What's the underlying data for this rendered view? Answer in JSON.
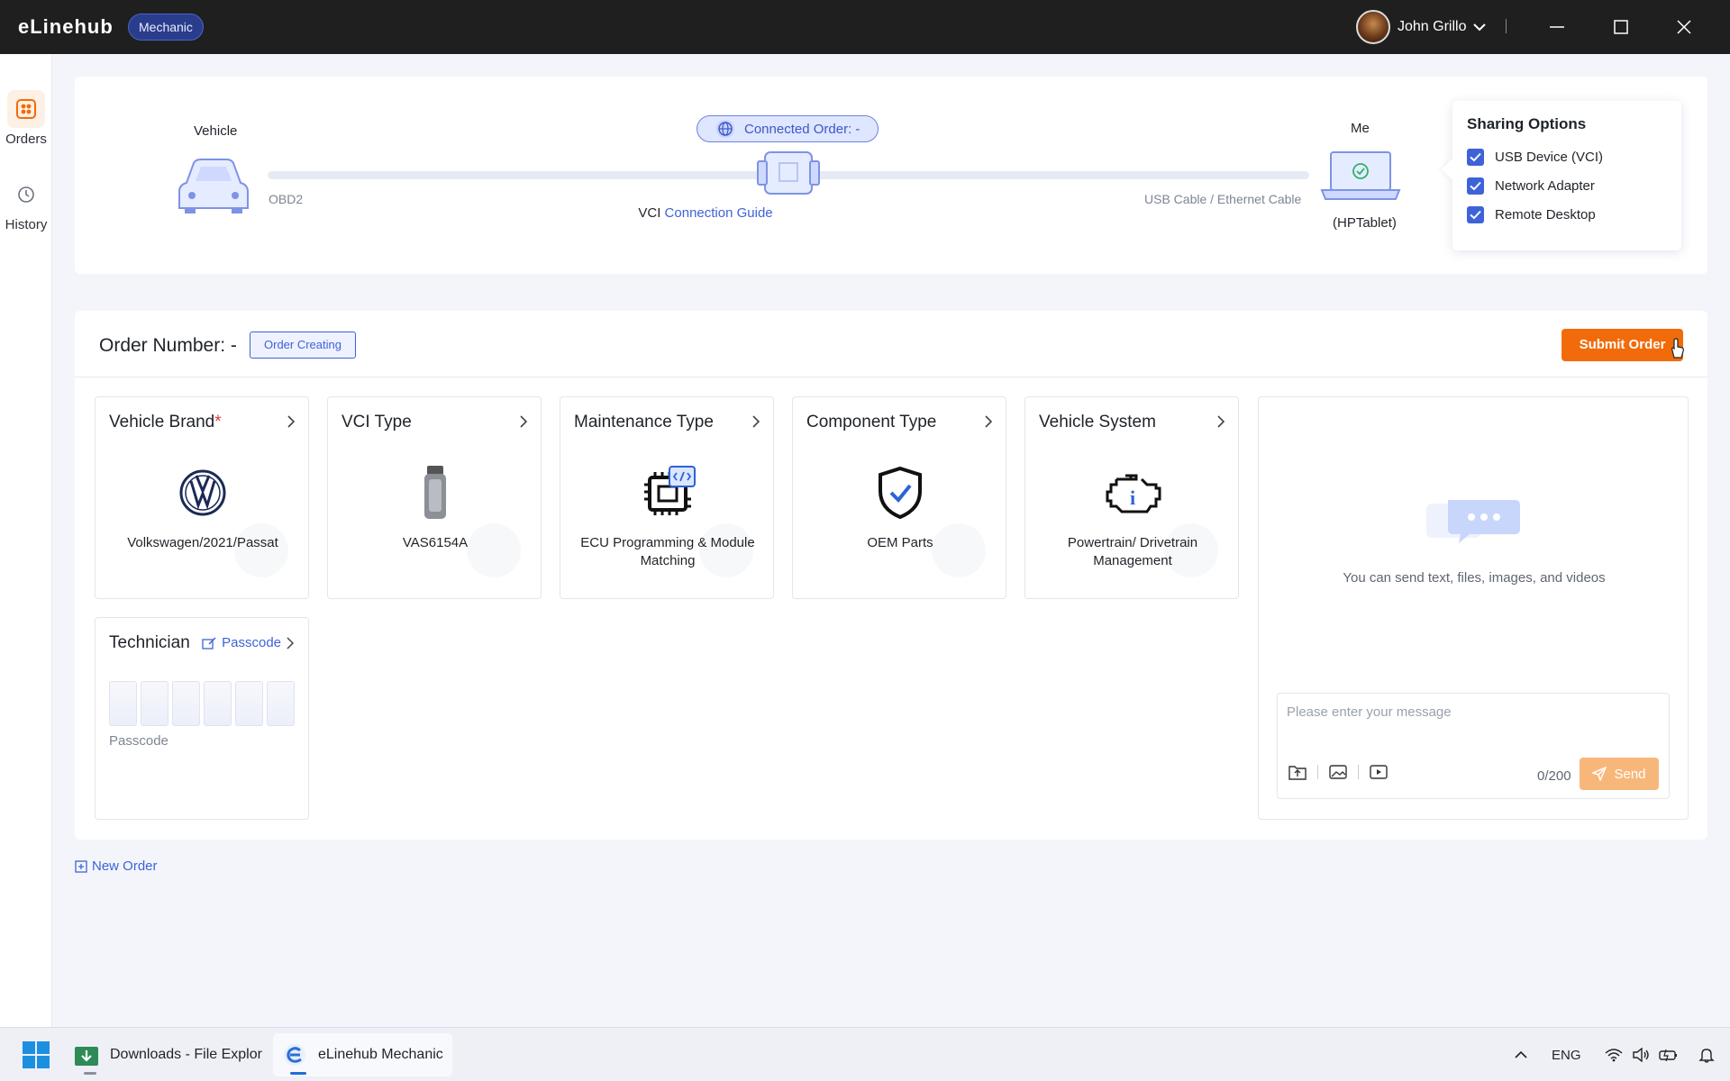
{
  "app": {
    "brand": "eLinehub",
    "role_badge": "Mechanic"
  },
  "user": {
    "name": "John Grillo"
  },
  "sidebar": {
    "items": [
      {
        "label": "Orders",
        "icon": "grid-icon",
        "active": true
      },
      {
        "label": "History",
        "icon": "history-icon",
        "active": false
      }
    ]
  },
  "connection": {
    "vehicle_label": "Vehicle",
    "obd_label": "OBD2",
    "connected_order": "Connected Order: -",
    "vci_prefix": "VCI",
    "vci_guide": "Connection Guide",
    "cable_label": "USB Cable / Ethernet Cable",
    "me_label": "Me",
    "device_name": "(HPTablet)"
  },
  "sharing": {
    "title": "Sharing Options",
    "options": [
      {
        "label": "USB Device (VCI)",
        "checked": true
      },
      {
        "label": "Network Adapter",
        "checked": true
      },
      {
        "label": "Remote Desktop",
        "checked": true
      }
    ]
  },
  "order": {
    "title": "Order Number: -",
    "status": "Order Creating",
    "submit_label": "Submit Order",
    "cards": [
      {
        "title": "Vehicle Brand",
        "required": "*",
        "value": "Volkswagen/2021/Passat",
        "icon": "volkswagen-logo-icon"
      },
      {
        "title": "VCI Type",
        "value": "VAS6154A",
        "icon": "vci-device-icon"
      },
      {
        "title": "Maintenance Type",
        "value": "ECU Programming & Module Matching",
        "icon": "chip-code-icon"
      },
      {
        "title": "Component Type",
        "value": "OEM Parts",
        "icon": "shield-check-icon"
      },
      {
        "title": "Vehicle System",
        "value": "Powertrain/ Drivetrain Management",
        "icon": "engine-info-icon"
      }
    ],
    "technician": {
      "title": "Technician",
      "passcode_link": "Passcode",
      "passcode_label": "Passcode"
    }
  },
  "chat": {
    "hint": "You can send text, files, images, and videos",
    "placeholder": "Please enter your message",
    "counter": "0/200",
    "send_label": "Send"
  },
  "new_order_label": "New Order",
  "taskbar": {
    "items": [
      {
        "label": "Downloads - File Explor",
        "icon": "file-explorer-icon"
      },
      {
        "label": "eLinehub Mechanic",
        "icon": "elinehub-icon"
      }
    ],
    "language": "ENG"
  },
  "colors": {
    "accent": "#f26b0a",
    "primary": "#3e62d8",
    "titlebar": "#1f1f1f"
  }
}
